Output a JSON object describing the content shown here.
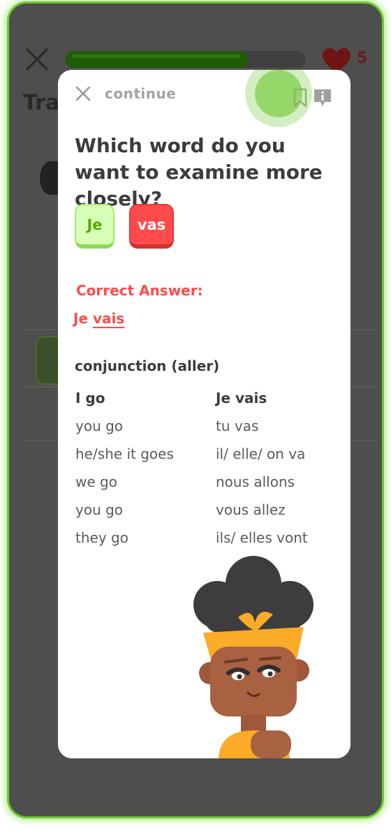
{
  "background": {
    "title_partial": "Tra",
    "progress_fraction": 0.76,
    "hearts_count": "5"
  },
  "modal": {
    "continue_label": "continue",
    "question": "Which word do you want to examine more closely?",
    "words": [
      "Je",
      "vas"
    ],
    "correct_answer_label": "Correct Answer:",
    "correct_answer": {
      "first": "Je",
      "second": "vais"
    },
    "conjugation": {
      "title": "conjunction (aller)",
      "rows": [
        [
          "I go",
          "Je vais"
        ],
        [
          "you go",
          "tu vas"
        ],
        [
          "he/she it goes",
          "il/ elle/ on va"
        ],
        [
          "we go",
          "nous allons"
        ],
        [
          "you go",
          "vous allez"
        ],
        [
          "they go",
          "ils/ elles vont"
        ]
      ]
    }
  },
  "colors": {
    "accent_green": "#58cc02",
    "error_red": "#ff4b4b"
  },
  "icons": [
    "close-icon",
    "heart-icon",
    "bookmark-icon",
    "info-icon"
  ]
}
